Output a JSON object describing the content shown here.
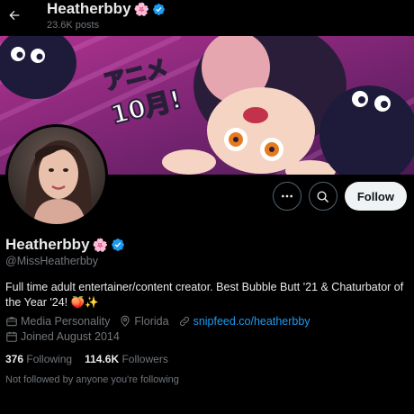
{
  "header": {
    "name": "Heatherbby",
    "name_emoji": "🌸",
    "posts_count": "23.6K posts"
  },
  "actions": {
    "more_label": "More",
    "follow_label": "Follow"
  },
  "profile": {
    "display_name": "Heatherbby",
    "name_emoji": "🌸",
    "handle": "@MissHeatherbby",
    "bio": "Full time adult entertainer/content creator. Best Bubble Butt '21 & Chaturbator of the Year '24! 🍑✨",
    "category": "Media Personality",
    "location": "Florida",
    "website": "snipfeed.co/heatherbby",
    "joined": "Joined August 2014"
  },
  "stats": {
    "following_count": "376",
    "following_label": "Following",
    "followers_count": "114.6K",
    "followers_label": "Followers"
  },
  "followed_by": "Not followed by anyone you're following",
  "banner": {
    "text_line1": "アニメ",
    "text_line2": "10月!"
  },
  "colors": {
    "background": "#000000",
    "accent_blue": "#1d9bf0",
    "verified_blue": "#1d9bf0",
    "muted_text": "#71767b",
    "primary_text": "#e7e9ea",
    "banner_purple": "#8a2a78",
    "follow_button_bg": "#eff3f4"
  },
  "icons": {
    "back": "arrow-left-icon",
    "verified": "verified-badge-icon",
    "more": "more-dots-icon",
    "search": "search-icon",
    "category": "briefcase-icon",
    "location": "location-pin-icon",
    "link": "link-icon",
    "calendar": "calendar-icon"
  }
}
